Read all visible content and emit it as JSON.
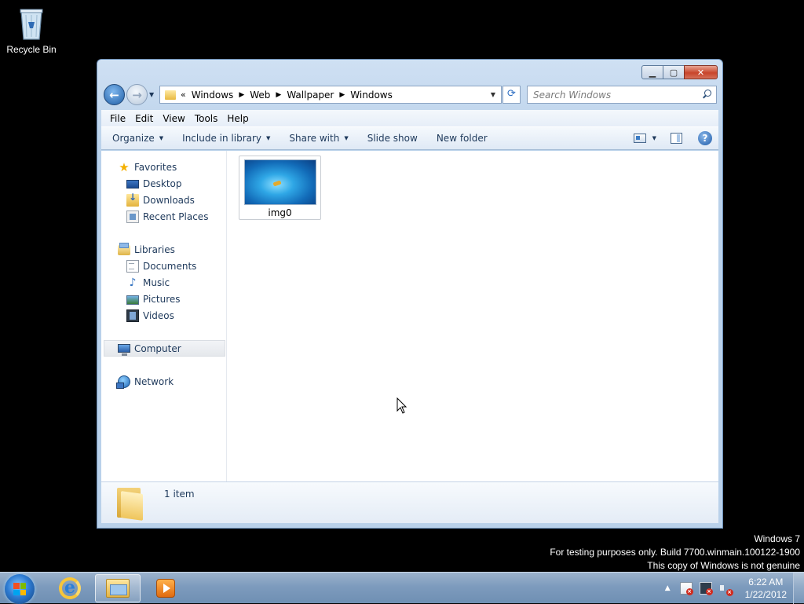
{
  "desktop": {
    "icons": [
      {
        "label": "Recycle Bin",
        "icon": "recycle-bin-icon"
      }
    ]
  },
  "window": {
    "caption_buttons": {
      "minimize": "▁",
      "maximize": "▢",
      "close": "✕"
    },
    "nav": {
      "back": "←",
      "forward": "→",
      "dropdown": "▼"
    },
    "address": {
      "overflow": "«",
      "separator": "▶",
      "crumbs": [
        "Windows",
        "Web",
        "Wallpaper",
        "Windows"
      ],
      "dropdown": "▼",
      "refresh": "⟳"
    },
    "search": {
      "placeholder": "Search Windows"
    },
    "menubar": [
      "File",
      "Edit",
      "View",
      "Tools",
      "Help"
    ],
    "commandbar": {
      "organize": "Organize",
      "include_in_library": "Include in library",
      "share_with": "Share with",
      "slide_show": "Slide show",
      "new_folder": "New folder",
      "caret": "▼",
      "help": "?"
    },
    "navpane": {
      "favorites": {
        "label": "Favorites",
        "icon": "star-icon",
        "star": "★",
        "items": [
          "Desktop",
          "Downloads",
          "Recent Places"
        ]
      },
      "libraries": {
        "label": "Libraries",
        "items": [
          "Documents",
          "Music",
          "Pictures",
          "Videos"
        ],
        "music_glyph": "♪"
      },
      "computer": {
        "label": "Computer"
      },
      "network": {
        "label": "Network"
      }
    },
    "files": [
      {
        "name": "img0",
        "type": "image"
      }
    ],
    "details": {
      "item_count": "1 item"
    }
  },
  "watermark": {
    "line1": "Windows 7",
    "line2": "For testing purposes only. Build 7700.winmain.100122-1900",
    "line3": "This copy of Windows is not genuine"
  },
  "taskbar": {
    "apps": [
      "internet-explorer",
      "windows-explorer",
      "windows-media-player"
    ],
    "ie_glyph": "e",
    "tray_arrow": "▲",
    "x_mark": "×",
    "clock": {
      "time": "6:22 AM",
      "date": "1/22/2012"
    }
  }
}
